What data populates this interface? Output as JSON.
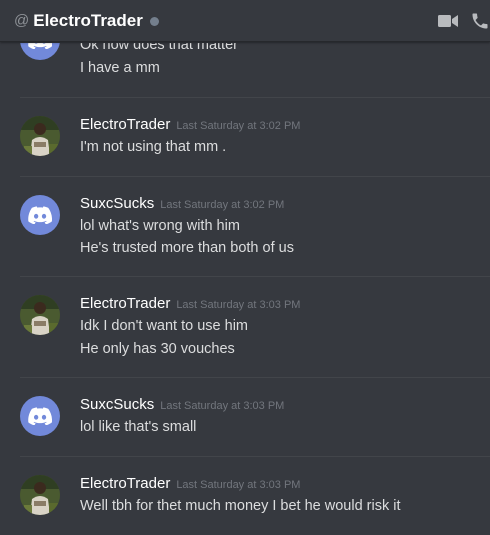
{
  "header": {
    "at_symbol": "@",
    "title": "ElectroTrader",
    "status_color": "#747f8d",
    "icons": [
      "video-camera-icon",
      "phone-icon"
    ]
  },
  "colors": {
    "background": "#36393f",
    "discord_blurple": "#7289da",
    "text": "#dcddde",
    "timestamp": "#72767d"
  },
  "messages": [
    {
      "author": "",
      "timestamp": "",
      "avatar": "discord-logo",
      "lines": [
        "Ok how does that matter",
        "I have a mm"
      ]
    },
    {
      "author": "ElectroTrader",
      "timestamp": "Last Saturday at 3:02 PM",
      "avatar": "photo",
      "lines": [
        "I'm not using that mm ."
      ]
    },
    {
      "author": "SuxcSucks",
      "timestamp": "Last Saturday at 3:02 PM",
      "avatar": "discord-logo",
      "lines": [
        "lol what's wrong with him",
        "He's trusted more than both of us"
      ]
    },
    {
      "author": "ElectroTrader",
      "timestamp": "Last Saturday at 3:03 PM",
      "avatar": "photo",
      "lines": [
        "Idk I don't want to use him",
        "He only has 30 vouches"
      ]
    },
    {
      "author": "SuxcSucks",
      "timestamp": "Last Saturday at 3:03 PM",
      "avatar": "discord-logo",
      "lines": [
        "lol like that's small"
      ]
    },
    {
      "author": "ElectroTrader",
      "timestamp": "Last Saturday at 3:03 PM",
      "avatar": "photo",
      "lines": [
        "Well tbh for thet much money I bet he would risk it"
      ]
    }
  ]
}
